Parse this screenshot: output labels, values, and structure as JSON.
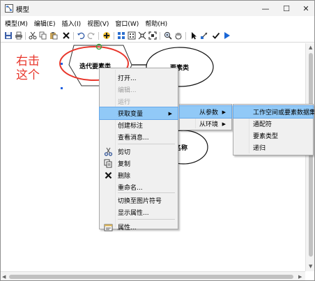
{
  "window": {
    "title": "模型",
    "minimize_glyph": "—",
    "maximize_glyph": "☐",
    "close_glyph": "✕"
  },
  "menubar": [
    {
      "label": "模型(M)",
      "name": "menu-model"
    },
    {
      "label": "编辑(E)",
      "name": "menu-edit"
    },
    {
      "label": "插入(I)",
      "name": "menu-insert"
    },
    {
      "label": "视图(V)",
      "name": "menu-view"
    },
    {
      "label": "窗口(W)",
      "name": "menu-window"
    },
    {
      "label": "帮助(H)",
      "name": "menu-help"
    }
  ],
  "annotation": {
    "line1": "右击",
    "line2": "这个",
    "color": "#e8362b"
  },
  "model": {
    "iterator_label": "迭代要素类",
    "feature_class_label": "要素类",
    "name_label": "名称"
  },
  "context_menu": {
    "items": [
      {
        "label": "打开...",
        "name": "ctx-open",
        "enabled": true,
        "icon": null
      },
      {
        "label": "编辑...",
        "name": "ctx-edit",
        "enabled": false,
        "icon": null
      },
      {
        "label": "运行",
        "name": "ctx-run",
        "enabled": false,
        "icon": null
      },
      {
        "label": "获取变量",
        "name": "ctx-get-variable",
        "enabled": true,
        "highlighted": true,
        "submenu": true,
        "icon": null
      },
      {
        "label": "创建标注",
        "name": "ctx-create-label",
        "enabled": true,
        "icon": null
      },
      {
        "label": "查看消息...",
        "name": "ctx-view-messages",
        "enabled": true,
        "icon": null
      },
      {
        "label": "剪切",
        "name": "ctx-cut",
        "enabled": true,
        "icon": "scissors-icon"
      },
      {
        "label": "复制",
        "name": "ctx-copy",
        "enabled": true,
        "icon": "copy-icon"
      },
      {
        "label": "删除",
        "name": "ctx-delete",
        "enabled": true,
        "icon": "delete-icon"
      },
      {
        "label": "重命名...",
        "name": "ctx-rename",
        "enabled": true,
        "icon": null
      },
      {
        "label": "切换至图片符号",
        "name": "ctx-switch-graphic",
        "enabled": true,
        "icon": null
      },
      {
        "label": "显示属性...",
        "name": "ctx-show-properties",
        "enabled": true,
        "icon": null
      },
      {
        "label": "属性...",
        "name": "ctx-properties",
        "enabled": true,
        "icon": "properties-icon"
      }
    ]
  },
  "submenu_variable": {
    "items": [
      {
        "label": "从参数",
        "name": "sub-from-parameter",
        "highlighted": true
      },
      {
        "label": "从环境",
        "name": "sub-from-environment",
        "highlighted": false
      }
    ]
  },
  "submenu_parameter": {
    "items": [
      {
        "label": "工作空间或要素数据集",
        "name": "sub2-workspace",
        "highlighted": true
      },
      {
        "label": "通配符",
        "name": "sub2-wildcard",
        "highlighted": false
      },
      {
        "label": "要素类型",
        "name": "sub2-feature-type",
        "highlighted": false
      },
      {
        "label": "递归",
        "name": "sub2-recursive",
        "highlighted": false
      }
    ]
  },
  "colors": {
    "highlight": "#91c9f7",
    "annotation_red": "#e8362b",
    "run_blue": "#1a66d6"
  }
}
